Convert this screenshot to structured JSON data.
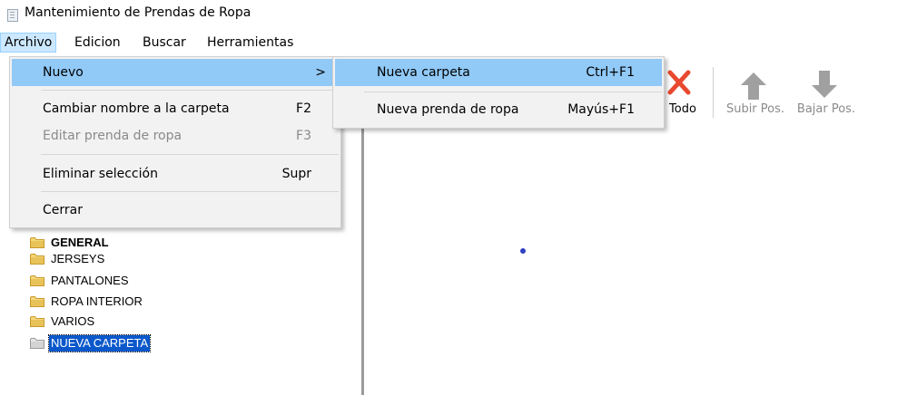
{
  "window": {
    "title": "Mantenimiento de Prendas de Ropa"
  },
  "menubar": {
    "items": [
      {
        "label": "Archivo"
      },
      {
        "label": "Edicion"
      },
      {
        "label": "Buscar"
      },
      {
        "label": "Herramientas"
      }
    ]
  },
  "archivo_menu": {
    "items": [
      {
        "label": "Nuevo",
        "shortcut": "",
        "submenu_arrow": ">"
      },
      {
        "label": "Cambiar nombre a la carpeta",
        "shortcut": "F2"
      },
      {
        "label": "Editar prenda de ropa",
        "shortcut": "F3"
      },
      {
        "label": "Eliminar selección",
        "shortcut": "Supr"
      },
      {
        "label": "Cerrar",
        "shortcut": ""
      }
    ]
  },
  "nuevo_submenu": {
    "items": [
      {
        "label": "Nueva carpeta",
        "shortcut": "Ctrl+F1"
      },
      {
        "label": "Nueva prenda de ropa",
        "shortcut": "Mayús+F1"
      }
    ]
  },
  "toolbar": {
    "todo_label": "Todo",
    "subir_label": "Subir Pos.",
    "bajar_label": "Bajar Pos."
  },
  "tree": {
    "items": [
      {
        "label": "GENERAL"
      },
      {
        "label": "JERSEYS"
      },
      {
        "label": "PANTALONES"
      },
      {
        "label": "ROPA INTERIOR"
      },
      {
        "label": "VARIOS"
      },
      {
        "label": "NUEVA CARPETA"
      }
    ]
  },
  "colors": {
    "menu_highlight": "#91c9f7",
    "tree_selection": "#0a58cb",
    "folder_yellow": "#e8c35a",
    "delete_red": "#e8492f",
    "arrow_gray": "#a0a0a0"
  }
}
